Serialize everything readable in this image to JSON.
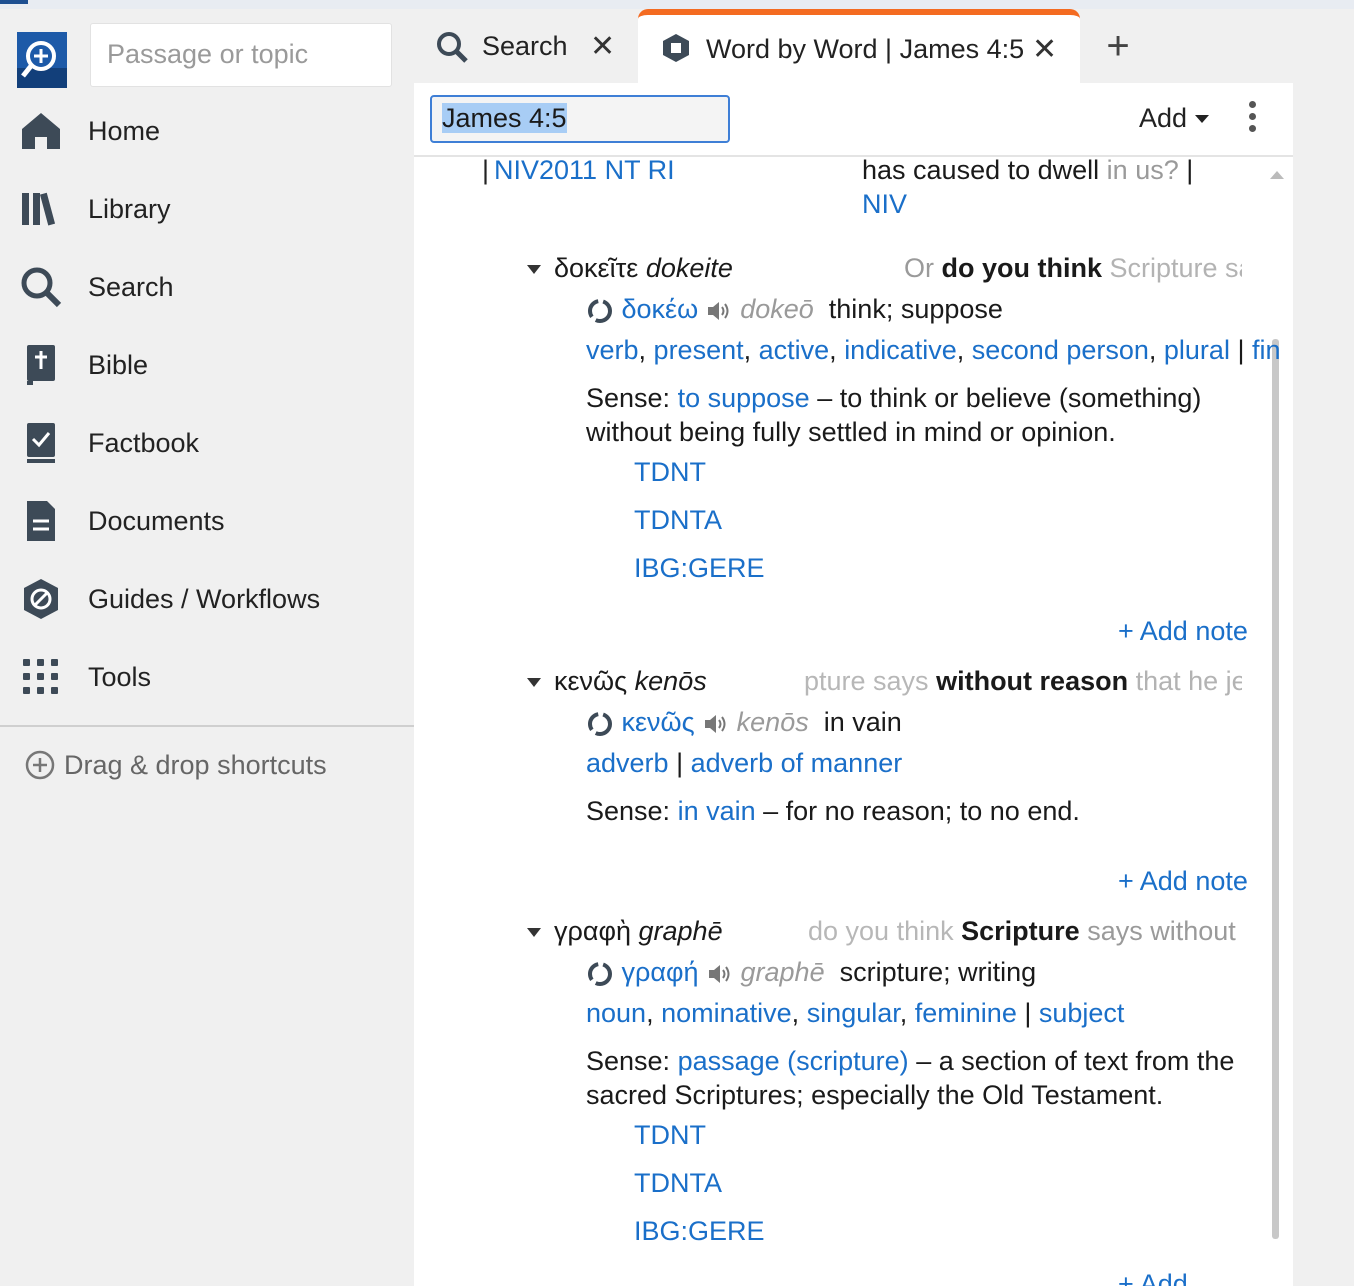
{
  "sidebar": {
    "passage_placeholder": "Passage or topic",
    "items": [
      {
        "label": "Home",
        "icon": "home-icon"
      },
      {
        "label": "Library",
        "icon": "library-icon"
      },
      {
        "label": "Search",
        "icon": "search-icon"
      },
      {
        "label": "Bible",
        "icon": "bible-icon"
      },
      {
        "label": "Factbook",
        "icon": "factbook-icon"
      },
      {
        "label": "Documents",
        "icon": "documents-icon"
      },
      {
        "label": "Guides / Workflows",
        "icon": "guides-icon"
      },
      {
        "label": "Tools",
        "icon": "tools-icon"
      }
    ],
    "drag_drop": "Drag & drop shortcuts"
  },
  "tabs": [
    {
      "label": "Search",
      "icon": "search-icon",
      "close": "✕"
    },
    {
      "label": "Word by Word | James 4:5",
      "icon": "book-icon",
      "close": "✕",
      "active": true
    }
  ],
  "add_tab": "+",
  "toolbar": {
    "reference": "James 4:5",
    "add": "Add"
  },
  "top_section": {
    "version_label": "NIV2011 NT RI",
    "bar": "|",
    "verse_text": "has caused to dwell",
    "verse_text_gray": "in us?",
    "verse_bar": "|",
    "verse_version": "NIV"
  },
  "words": [
    {
      "greek": "δοκεῖτε",
      "translit": "dokeite",
      "context_before": "Or",
      "context_bold": "do you think",
      "context_after": "Scripture sa",
      "lemma": "δοκέω",
      "lemma_translit": "dokeō",
      "gloss": "think; suppose",
      "morph": [
        "verb",
        "present",
        "active",
        "indicative",
        "second person",
        "plural"
      ],
      "morph_extra": "fin",
      "sense_label": "Sense:",
      "sense_link": "to suppose",
      "sense_text": "– to think or believe (something)",
      "sense_text2": "without being fully settled in mind or opinion.",
      "refs": [
        "TDNT",
        "TDNTA",
        "IBG:GERE"
      ],
      "add_note": "+ Add note"
    },
    {
      "greek": "κενῶς",
      "translit": "kenōs",
      "context_before": "pture says",
      "context_bold": "without reason",
      "context_after": "that he jea",
      "lemma": "κενῶς",
      "lemma_translit": "kenōs",
      "gloss": "in vain",
      "morph": [
        "adverb"
      ],
      "morph_extra": "adverb of manner",
      "sense_label": "Sense:",
      "sense_link": "in vain",
      "sense_text": "– for no reason; to no end.",
      "add_note": "+ Add note"
    },
    {
      "greek": "γραφὴ",
      "translit": "graphē",
      "context_before": "do you think",
      "context_bold": "Scripture",
      "context_after": "says without",
      "lemma": "γραφή",
      "lemma_translit": "graphē",
      "gloss": "scripture; writing",
      "morph": [
        "noun",
        "nominative",
        "singular",
        "feminine"
      ],
      "morph_extra": "subject",
      "sense_label": "Sense:",
      "sense_link": "passage (scripture)",
      "sense_text": "– a section of text from the",
      "sense_text2": "sacred Scriptures; especially the Old Testament.",
      "refs": [
        "TDNT",
        "TDNTA",
        "IBG:GERE"
      ],
      "add_note": "+ Add"
    }
  ],
  "colors": {
    "accent": "#1a6fc9",
    "tab_active": "#f46b21",
    "logo": "#1d5aa8"
  }
}
